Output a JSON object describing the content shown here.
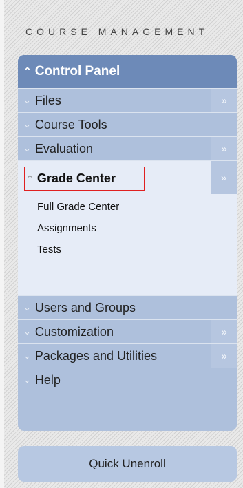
{
  "header": {
    "title": "COURSE MANAGEMENT"
  },
  "panel": {
    "title": "Control Panel",
    "title_icon": "chevron-up-icon",
    "items": [
      {
        "label": "Files",
        "has_arrow": true
      },
      {
        "label": "Course Tools",
        "has_arrow": false
      },
      {
        "label": "Evaluation",
        "has_arrow": true
      }
    ],
    "grade_center": {
      "label": "Grade Center",
      "subitems": [
        "Full Grade Center",
        "Assignments",
        "Tests"
      ]
    },
    "items_after": [
      {
        "label": "Users and Groups",
        "has_arrow": false
      },
      {
        "label": "Customization",
        "has_arrow": true
      },
      {
        "label": "Packages and Utilities",
        "has_arrow": true
      },
      {
        "label": "Help",
        "has_arrow": false
      }
    ]
  },
  "icons": {
    "collapse": "chevron-up-icon",
    "expand": "chevron-down-icon",
    "open_page": "double-chevron-right-icon"
  },
  "quick_unenroll": {
    "label": "Quick Unenroll"
  }
}
